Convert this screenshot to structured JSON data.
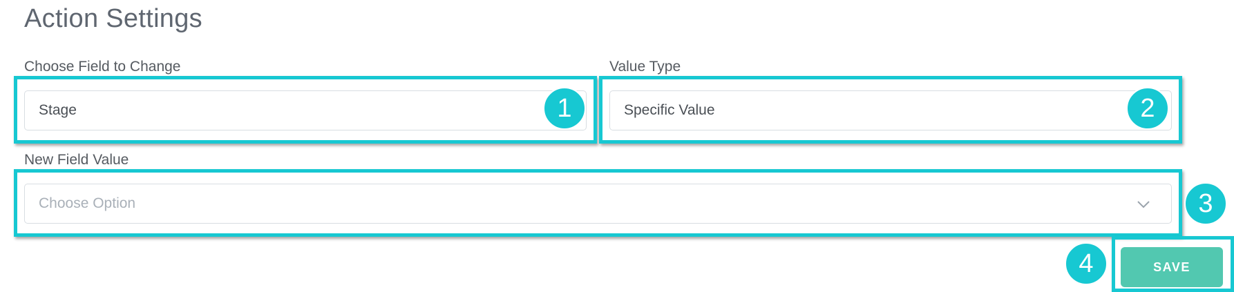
{
  "page": {
    "title": "Action Settings"
  },
  "form": {
    "field_to_change": {
      "label": "Choose Field to Change",
      "value": "Stage"
    },
    "value_type": {
      "label": "Value Type",
      "value": "Specific Value"
    },
    "new_field_value": {
      "label": "New Field Value",
      "placeholder": "Choose Option"
    },
    "save_label": "SAVE"
  },
  "annotations": [
    "1",
    "2",
    "3",
    "4"
  ],
  "colors": {
    "highlight": "#17c8d2",
    "save_button": "#52c8b0",
    "text": "#4a4f55",
    "placeholder": "#a9b0b8"
  },
  "icons": {
    "dropdown": "chevron-down-icon"
  }
}
